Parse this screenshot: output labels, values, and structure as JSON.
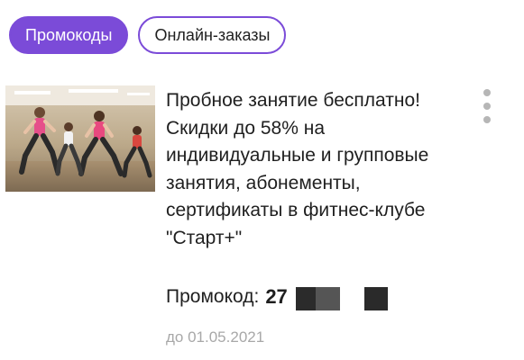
{
  "tabs": [
    {
      "label": "Промокоды",
      "active": true
    },
    {
      "label": "Онлайн-заказы",
      "active": false
    }
  ],
  "offer": {
    "image_icon": "fitness-class-photo",
    "text": "Пробное занятие бесплатно!\nСкидки до 58% на\nиндивидуальные и групповые\nзанятия, абонементы,\nсертификаты в фитнес-клубе\n\"Старт+\"",
    "promo_label": "Промокод:",
    "promo_code_visible": "27",
    "expiry": "до 01.05.2021",
    "menu_icon": "more-vertical-icon"
  },
  "colors": {
    "accent": "#7b4bd8",
    "text": "#1f1f1f",
    "muted": "#a8a8a8"
  }
}
